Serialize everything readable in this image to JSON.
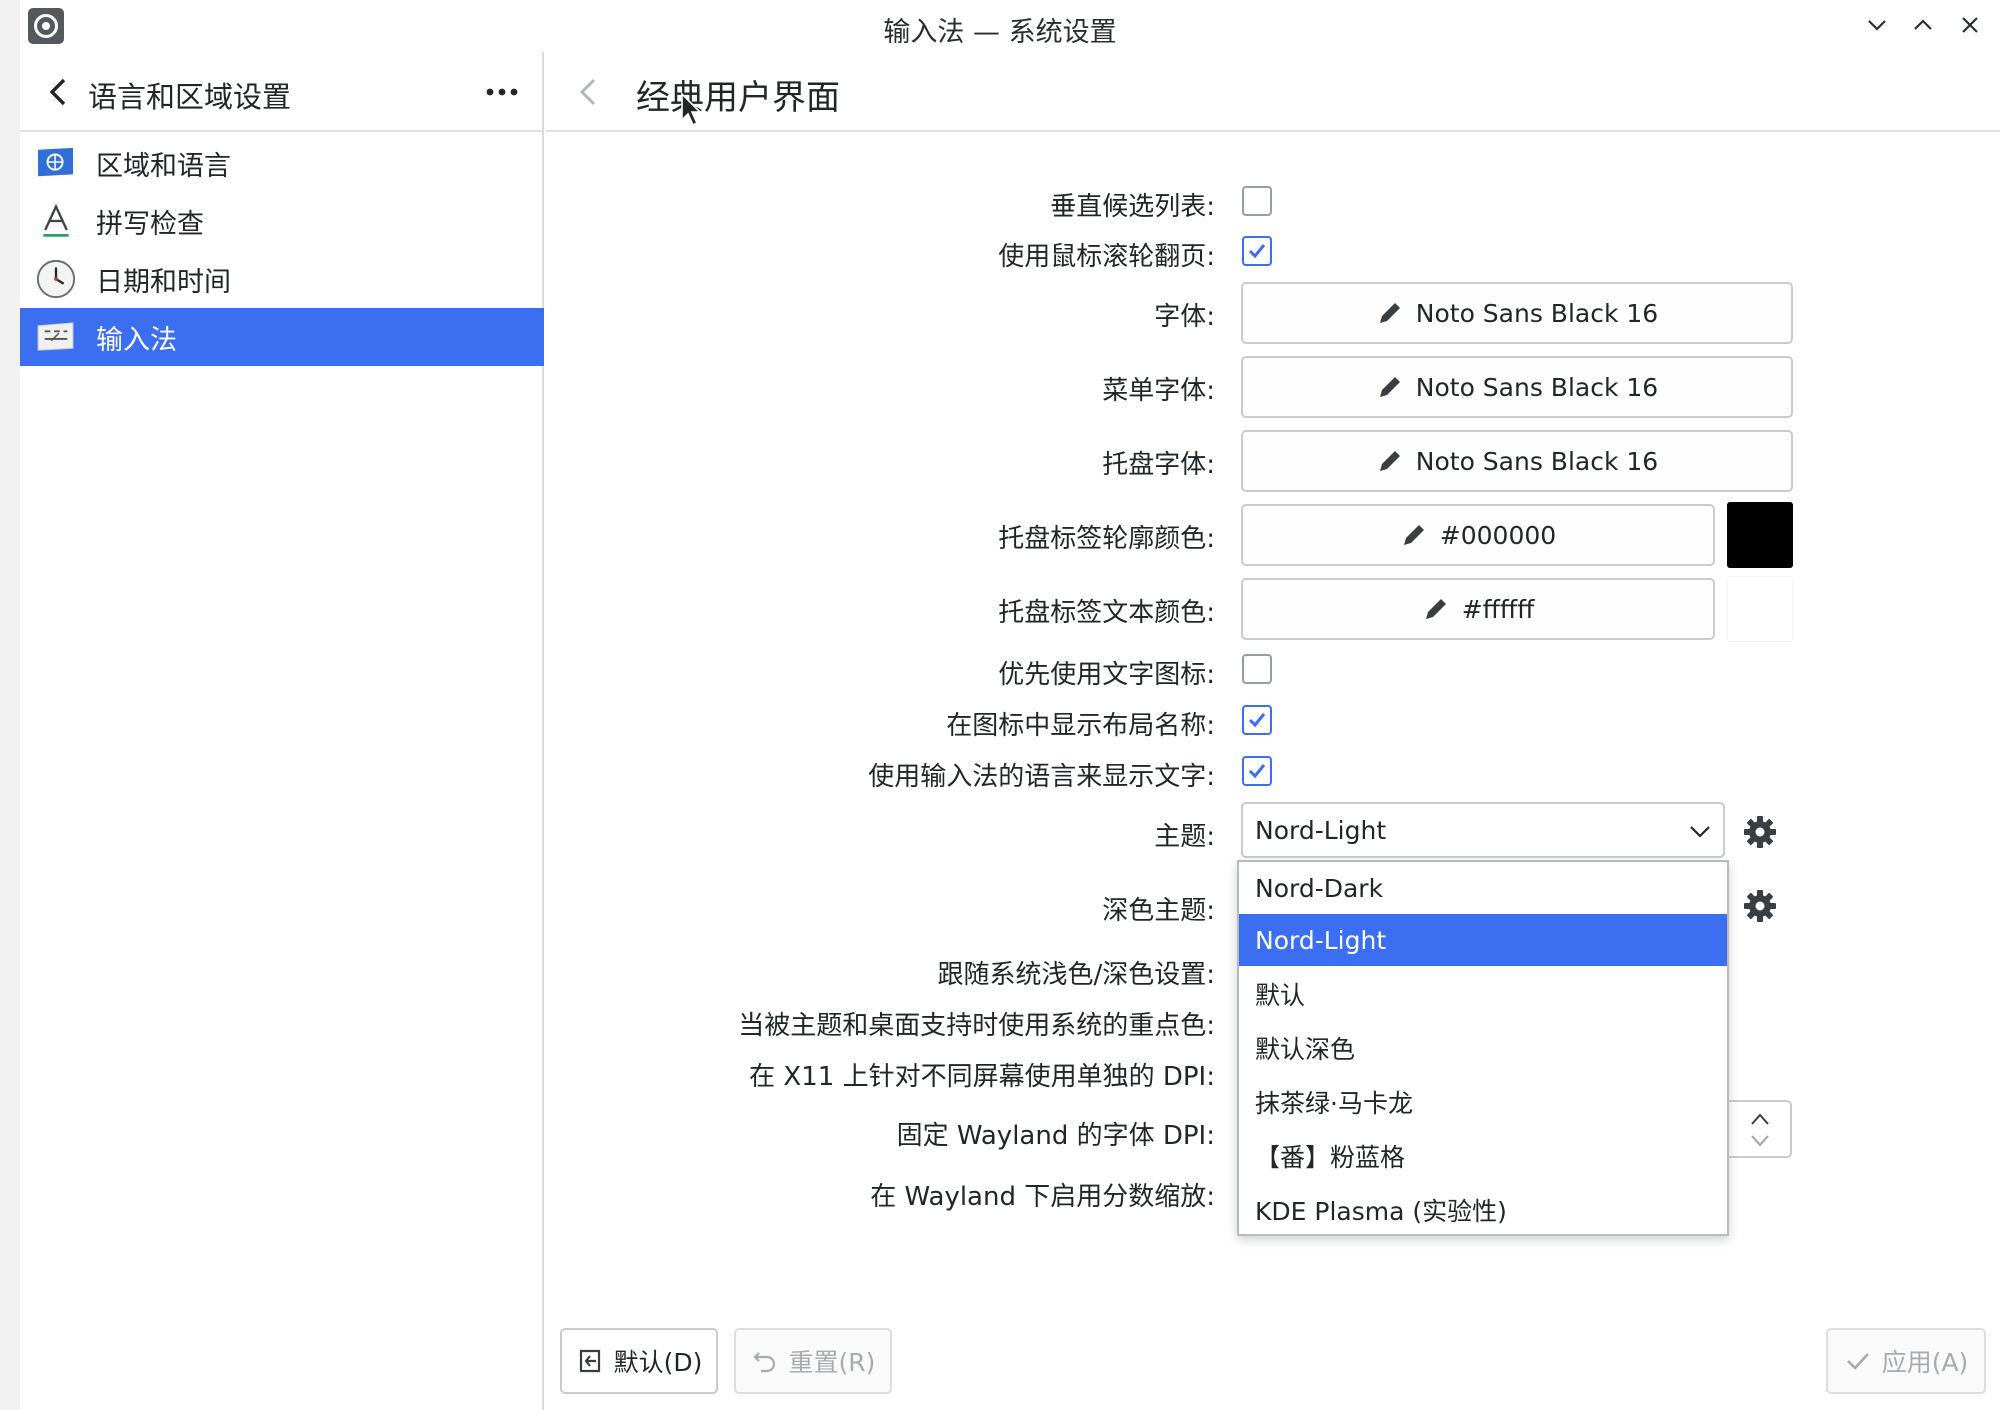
{
  "window": {
    "title": "输入法 — 系统设置",
    "controls": [
      "minimize",
      "maximize",
      "close"
    ]
  },
  "sidebar": {
    "title": "语言和区域设置",
    "items": [
      {
        "label": "区域和语言",
        "icon": "globe-flag-icon",
        "active": false
      },
      {
        "label": "拼写检查",
        "icon": "spellcheck-icon",
        "active": false
      },
      {
        "label": "日期和时间",
        "icon": "clock-icon",
        "active": false
      },
      {
        "label": "输入法",
        "icon": "keyboard-icon",
        "active": true
      }
    ]
  },
  "main": {
    "title": "经典用户界面",
    "rows": {
      "vertical_list": {
        "label": "垂直候选列表:",
        "checked": false
      },
      "wheel_page": {
        "label": "使用鼠标滚轮翻页:",
        "checked": true
      },
      "font": {
        "label": "字体:",
        "value": "Noto Sans Black 16"
      },
      "menu_font": {
        "label": "菜单字体:",
        "value": "Noto Sans Black 16"
      },
      "tray_font": {
        "label": "托盘字体:",
        "value": "Noto Sans Black 16"
      },
      "tray_outline_color": {
        "label": "托盘标签轮廓颜色:",
        "value": "#000000",
        "swatch": "#000000"
      },
      "tray_text_color": {
        "label": "托盘标签文本颜色:",
        "value": "#ffffff",
        "swatch": "#ffffff"
      },
      "prefer_text_icon": {
        "label": "优先使用文字图标:",
        "checked": false
      },
      "show_layout_name": {
        "label": "在图标中显示布局名称:",
        "checked": true
      },
      "use_im_language": {
        "label": "使用输入法的语言来显示文字:",
        "checked": true
      },
      "theme": {
        "label": "主题:",
        "value": "Nord-Light"
      },
      "dark_theme": {
        "label": "深色主题:"
      },
      "follow_system": {
        "label": "跟随系统浅色/深色设置:"
      },
      "accent_color": {
        "label": "当被主题和桌面支持时使用系统的重点色:"
      },
      "x11_dpi": {
        "label": "在 X11 上针对不同屏幕使用单独的 DPI:"
      },
      "wayland_dpi": {
        "label": "固定 Wayland 的字体 DPI:"
      },
      "wayland_scale": {
        "label": "在 Wayland 下启用分数缩放:"
      }
    },
    "theme_options": [
      "Nord-Dark",
      "Nord-Light",
      "默认",
      "默认深色",
      "抹茶绿·马卡龙",
      "【番】粉蓝格",
      "KDE Plasma (实验性)"
    ],
    "theme_selected_index": 1
  },
  "footer": {
    "defaults": "默认(D)",
    "reset": "重置(R)",
    "apply": "应用(A)"
  },
  "colors": {
    "accent": "#3b6ef0",
    "text": "#232629"
  }
}
